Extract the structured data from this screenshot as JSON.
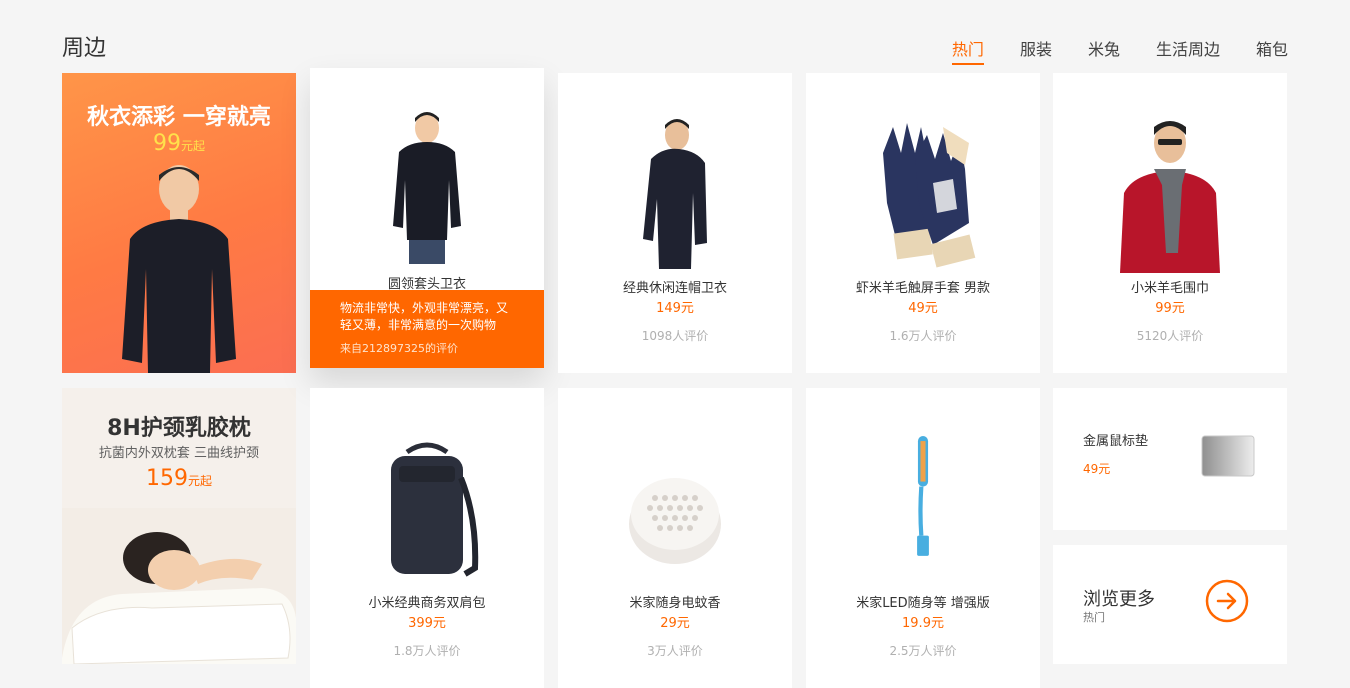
{
  "section": {
    "title": "周边"
  },
  "tabs": [
    {
      "label": "热门",
      "active": true
    },
    {
      "label": "服装"
    },
    {
      "label": "米兔"
    },
    {
      "label": "生活周边"
    },
    {
      "label": "箱包"
    }
  ],
  "promo1": {
    "title": "秋衣添彩 一穿就亮",
    "price": "99",
    "unit": "元起"
  },
  "promo2": {
    "title": "8H护颈乳胶枕",
    "subtitle": "抗菌内外双枕套  三曲线护颈",
    "price": "159",
    "unit": "元起"
  },
  "products": [
    {
      "name": "圆领套头卫衣",
      "review": "物流非常快，外观非常漂亮，又轻又薄，非常满意的一次购物",
      "review_author": "来自212897325的评价",
      "icon": "sweater-icon"
    },
    {
      "name": "经典休闲连帽卫衣",
      "price": "149元",
      "reviews": "1098人评价",
      "icon": "hoodie-icon"
    },
    {
      "name": "虾米羊毛触屏手套 男款",
      "price": "49元",
      "reviews": "1.6万人评价",
      "icon": "gloves-icon"
    },
    {
      "name": "小米羊毛围巾",
      "price": "99元",
      "reviews": "5120人评价",
      "icon": "scarf-icon"
    },
    {
      "name": "小米经典商务双肩包",
      "price": "399元",
      "reviews": "1.8万人评价",
      "icon": "backpack-icon"
    },
    {
      "name": "米家随身电蚊香",
      "price": "29元",
      "reviews": "3万人评价",
      "icon": "mosquito-repeller-icon"
    },
    {
      "name": "米家LED随身等 增强版",
      "price": "19.9元",
      "reviews": "2.5万人评价",
      "icon": "usb-lamp-icon"
    }
  ],
  "mini": {
    "name": "金属鼠标垫",
    "price": "49元"
  },
  "more": {
    "title": "浏览更多",
    "subtitle": "热门"
  },
  "colors": {
    "accent": "#ff6700",
    "background": "#f5f5f5"
  }
}
